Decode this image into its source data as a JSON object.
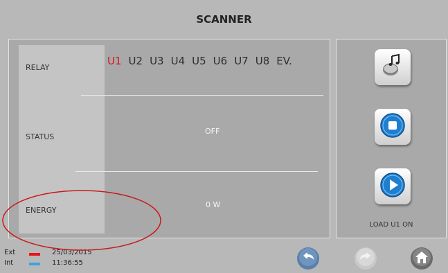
{
  "screen": {
    "title": "SCANNER"
  },
  "rows": {
    "relay_label": "RELAY",
    "status_label": "STATUS",
    "energy_label": "ENERGY",
    "status_value": "OFF",
    "energy_value": "0 W"
  },
  "relays": [
    "U1",
    "U2",
    "U3",
    "U4",
    "U5",
    "U6",
    "U7",
    "U8",
    "EV."
  ],
  "selected_relay": "U1",
  "side": {
    "music_button_icon": "music-note-icon",
    "stop_button_icon": "stop-icon",
    "play_button_icon": "play-icon",
    "status_text": "LOAD U1 ON"
  },
  "footer": {
    "ext_label": "Ext",
    "int_label": "Int",
    "date": "25/03/2015",
    "time": "11:36:55",
    "ext_color": "#e8121c",
    "int_color": "#3aa3e0"
  },
  "nav": {
    "back_icon": "back-arrow-icon",
    "forward_icon": "forward-arrow-icon",
    "home_icon": "home-icon"
  },
  "colors": {
    "accent_red": "#d8161b",
    "button_blue": "#1e7fd0",
    "annotation": "#c81a1a"
  }
}
